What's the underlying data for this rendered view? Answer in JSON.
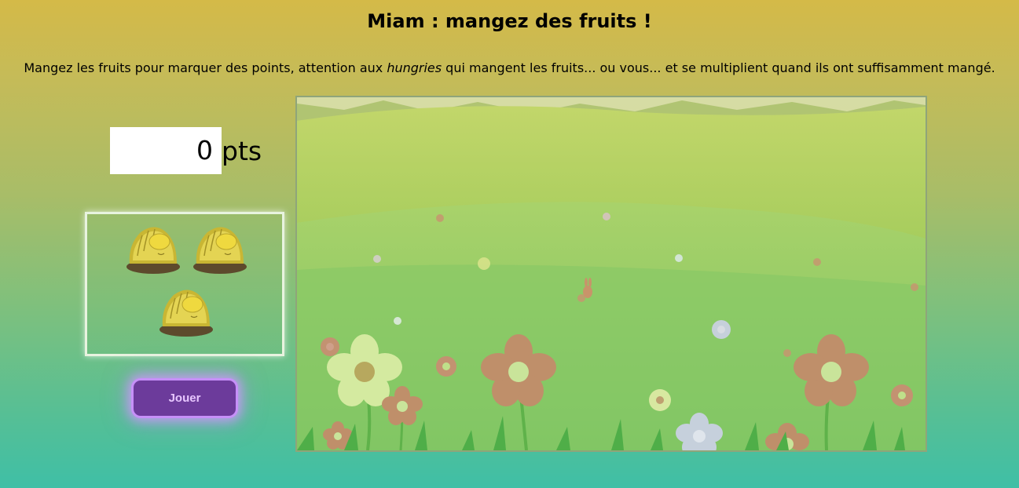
{
  "page": {
    "title": "Miam : mangez des fruits !",
    "intro_before": "Mangez les fruits pour marquer des points, attention aux ",
    "intro_em": "hungries",
    "intro_after": " qui mangent les fruits... ou vous... et se multiplient quand ils ont suffisamment mangé."
  },
  "score": {
    "value": "0",
    "unit": "pts"
  },
  "lives": {
    "count": 3,
    "icon": "hungry-creature-icon"
  },
  "controls": {
    "play_label": "Jouer"
  },
  "colors": {
    "background_top": "#d4ba48",
    "background_bottom": "#3fbfa6",
    "button": "#6c3b9b",
    "button_glow": "#c690f8"
  }
}
